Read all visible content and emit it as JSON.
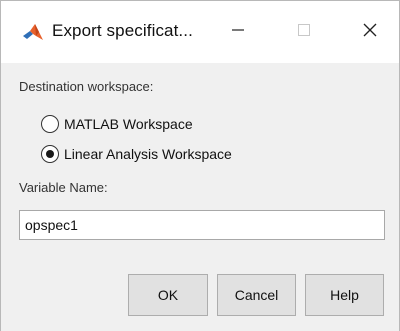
{
  "window": {
    "title": "Export specificat...",
    "icon": "matlab-icon",
    "controls": {
      "minimize": "minimize-icon",
      "maximize": "maximize-icon",
      "close": "close-icon"
    }
  },
  "destination": {
    "label": "Destination workspace:",
    "options": [
      {
        "label": "MATLAB Workspace",
        "checked": false
      },
      {
        "label": "Linear Analysis Workspace",
        "checked": true
      }
    ]
  },
  "variable": {
    "label": "Variable Name:",
    "value": "opspec1"
  },
  "buttons": {
    "ok": "OK",
    "cancel": "Cancel",
    "help": "Help"
  },
  "colors": {
    "dialog_bg": "#f0f0f0",
    "titlebar_bg": "#ffffff",
    "button_bg": "#e1e1e1",
    "matlab_orange": "#e8612c",
    "matlab_blue": "#2f6fb7"
  }
}
